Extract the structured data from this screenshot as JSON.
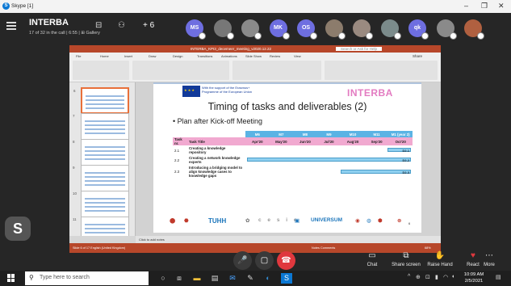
{
  "window": {
    "title": "Skype [1]",
    "minimize": "–",
    "maximize": "❐",
    "close": "✕"
  },
  "call": {
    "title": "INTERBA",
    "subtitle": "17 of 32 in the call | 6:55 | ⊞ Gallery",
    "extra_participants": "+ 6",
    "participants": [
      {
        "initials": "MS",
        "color": "#6e6ee0"
      },
      {
        "initials": "",
        "color": "#777777"
      },
      {
        "initials": "",
        "color": "#8a8a8a"
      },
      {
        "initials": "MK",
        "color": "#6e6ee0"
      },
      {
        "initials": "OS",
        "color": "#6e6ee0"
      },
      {
        "initials": "",
        "color": "#8c7c6c"
      },
      {
        "initials": "",
        "color": "#9a8a80"
      },
      {
        "initials": "",
        "color": "#7b8b8b"
      },
      {
        "initials": "qk",
        "color": "#6e6ee0"
      },
      {
        "initials": "",
        "color": "#8a8a8a"
      },
      {
        "initials": "",
        "color": "#b06040"
      }
    ],
    "self_initial": "S"
  },
  "ppt": {
    "title": "INTERBA_KPI3_decemeer_meeting_v2020.12.22",
    "search": "Search or Ask for Help",
    "share": "Share",
    "tabs": [
      "File",
      "Home",
      "Insert",
      "Draw",
      "Design",
      "Transitions",
      "Animations",
      "Slide Show",
      "Review",
      "View"
    ],
    "thumb_numbers": [
      "6",
      "7",
      "8",
      "9",
      "10",
      "11"
    ],
    "notes": "Click to add notes",
    "status_left": "Slide 6 of 17   English (United Kingdom)",
    "status_right": "Notes   Comments",
    "zoom": "68%"
  },
  "slide": {
    "eu_text": "With the support of the Erasmus+ Programme of the European Union",
    "brand": "INTERBA",
    "title": "Timing of tasks and deliverables (2)",
    "bullet": "• Plan after Kick-off Meeting",
    "months": [
      "M6",
      "M7",
      "M8",
      "M9",
      "M10",
      "M11",
      "M1 (year 2)"
    ],
    "header": {
      "task_nr": "Task nr.",
      "task_title": "Task Title",
      "dates": [
        "Apr'20",
        "May'20",
        "Jun'20",
        "Jul'20",
        "Aug'20",
        "Sep'20",
        "Oct'20"
      ]
    },
    "rows": [
      {
        "nr": "2.1",
        "title": "Creating a knowledge repository",
        "bar_start": 6,
        "bar_end": 7,
        "label": "D2.1"
      },
      {
        "nr": "2.2",
        "title": "Creating a network knowledge experts",
        "bar_start": 0,
        "bar_end": 7,
        "label": "D2.2"
      },
      {
        "nr": "2.3",
        "title": "Introducing a bridging model to align knowledge cases to knowledge gaps",
        "bar_start": 4,
        "bar_end": 7,
        "label": "D2.3"
      }
    ],
    "logos": [
      "TUHH",
      "UNIVERSUM"
    ],
    "page_number": "6"
  },
  "controls": {
    "mute": "🎤",
    "video": "▢",
    "end": "☎",
    "chat": "Chat",
    "share_screen": "Share screen",
    "raise_hand": "Raise Hand",
    "react": "React",
    "more": "More"
  },
  "taskbar": {
    "search_placeholder": "Type here to search",
    "time": "10:09 AM",
    "date": "2/5/2021"
  }
}
